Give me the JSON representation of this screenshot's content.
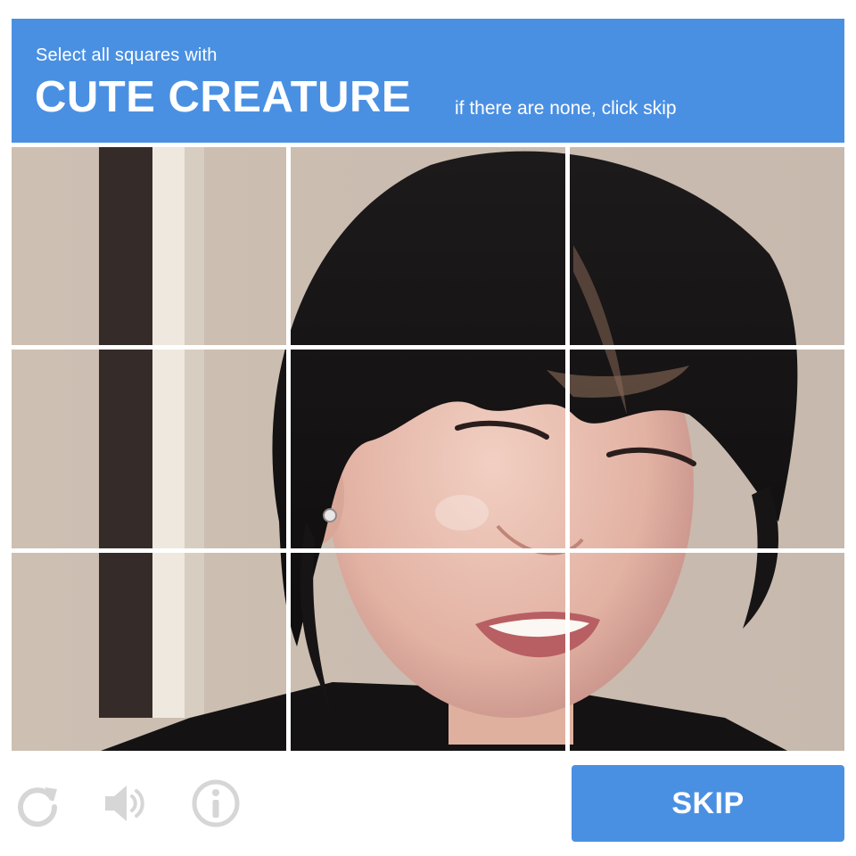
{
  "header": {
    "prompt": "Select all squares with",
    "keyword": "CUTE CREATURE",
    "hint": "if there are none, click skip"
  },
  "grid": {
    "rows": 3,
    "cols": 3,
    "tiles": [
      {
        "row": 1,
        "col": 1,
        "selected": false
      },
      {
        "row": 1,
        "col": 2,
        "selected": false
      },
      {
        "row": 1,
        "col": 3,
        "selected": false
      },
      {
        "row": 2,
        "col": 1,
        "selected": false
      },
      {
        "row": 2,
        "col": 2,
        "selected": false
      },
      {
        "row": 2,
        "col": 3,
        "selected": false
      },
      {
        "row": 3,
        "col": 1,
        "selected": false
      },
      {
        "row": 3,
        "col": 2,
        "selected": false
      },
      {
        "row": 3,
        "col": 3,
        "selected": false
      }
    ]
  },
  "footer": {
    "icons": [
      "reload-icon",
      "audio-icon",
      "info-icon"
    ],
    "skip_label": "SKIP"
  },
  "colors": {
    "accent": "#4a90e2",
    "icon_gray": "#d6d6d6",
    "background": "#ffffff"
  }
}
